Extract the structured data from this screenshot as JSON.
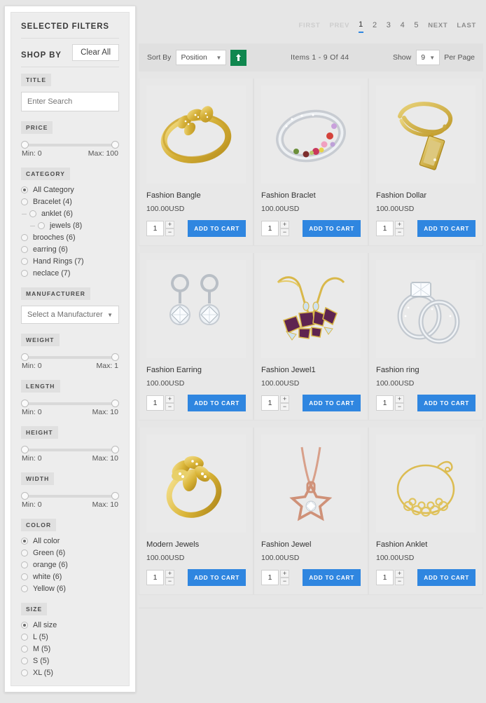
{
  "sidebar": {
    "selected_filters_title": "SELECTED FILTERS",
    "clear_all_label": "Clear All",
    "shop_by_title": "SHOP BY",
    "title_section": {
      "label": "TITLE",
      "search_placeholder": "Enter Search",
      "search_value": ""
    },
    "price_section": {
      "label": "PRICE",
      "min_text": "Min: 0",
      "max_text": "Max: 100"
    },
    "category_section": {
      "label": "CATEGORY",
      "options": [
        {
          "label": "All Category",
          "selected": true,
          "indent": 0
        },
        {
          "label": "Bracelet (4)",
          "selected": false,
          "indent": 0
        },
        {
          "label": "anklet (6)",
          "selected": false,
          "indent": 1
        },
        {
          "label": "jewels (8)",
          "selected": false,
          "indent": 2
        },
        {
          "label": "brooches (6)",
          "selected": false,
          "indent": 0
        },
        {
          "label": "earring (6)",
          "selected": false,
          "indent": 0
        },
        {
          "label": "Hand Rings (7)",
          "selected": false,
          "indent": 0
        },
        {
          "label": "neclace (7)",
          "selected": false,
          "indent": 0
        }
      ]
    },
    "manufacturer_section": {
      "label": "MANUFACTURER",
      "selected_value": "Select a Manufacturer"
    },
    "weight_section": {
      "label": "WEIGHT",
      "min_text": "Min: 0",
      "max_text": "Max: 1"
    },
    "length_section": {
      "label": "LENGTH",
      "min_text": "Min: 0",
      "max_text": "Max: 10"
    },
    "height_section": {
      "label": "HEIGHT",
      "min_text": "Min: 0",
      "max_text": "Max: 10"
    },
    "width_section": {
      "label": "WIDTH",
      "min_text": "Min: 0",
      "max_text": "Max: 10"
    },
    "color_section": {
      "label": "COLOR",
      "options": [
        {
          "label": "All color",
          "selected": true
        },
        {
          "label": "Green (6)",
          "selected": false
        },
        {
          "label": "orange (6)",
          "selected": false
        },
        {
          "label": "white (6)",
          "selected": false
        },
        {
          "label": "Yellow (6)",
          "selected": false
        }
      ]
    },
    "size_section": {
      "label": "SIZE",
      "options": [
        {
          "label": "All size",
          "selected": true
        },
        {
          "label": "L (5)",
          "selected": false
        },
        {
          "label": "M (5)",
          "selected": false
        },
        {
          "label": "S (5)",
          "selected": false
        },
        {
          "label": "XL (5)",
          "selected": false
        }
      ]
    }
  },
  "pagination": {
    "first": "FIRST",
    "prev": "PREV",
    "pages": [
      "1",
      "2",
      "3",
      "4",
      "5"
    ],
    "active_page": "1",
    "next": "NEXT",
    "last": "LAST"
  },
  "toolbar": {
    "sort_by_label": "Sort By",
    "sort_by_value": "Position",
    "sort_direction_icon": "arrow-up-icon",
    "items_text": "Items  1 - 9  Of  44",
    "show_label": "Show",
    "show_value": "9",
    "per_page_label": "Per Page"
  },
  "products": [
    {
      "name": "Fashion Bangle",
      "price": "100.00USD",
      "qty": "1",
      "add_to_cart": "ADD TO CART",
      "image": "gold-bangle"
    },
    {
      "name": "Fashion Braclet",
      "price": "100.00USD",
      "qty": "1",
      "add_to_cart": "ADD TO CART",
      "image": "silver-gem-bracelet"
    },
    {
      "name": "Fashion Dollar",
      "price": "100.00USD",
      "qty": "1",
      "add_to_cart": "ADD TO CART",
      "image": "gold-chain-pendant"
    },
    {
      "name": "Fashion Earring",
      "price": "100.00USD",
      "qty": "1",
      "add_to_cart": "ADD TO CART",
      "image": "silver-diamond-earrings"
    },
    {
      "name": "Fashion Jewel1",
      "price": "100.00USD",
      "qty": "1",
      "add_to_cart": "ADD TO CART",
      "image": "purple-gem-necklace-set"
    },
    {
      "name": "Fashion ring",
      "price": "100.00USD",
      "qty": "1",
      "add_to_cart": "ADD TO CART",
      "image": "silver-diamond-rings"
    },
    {
      "name": "Modern Jewels",
      "price": "100.00USD",
      "qty": "1",
      "add_to_cart": "ADD TO CART",
      "image": "gold-flower-ring"
    },
    {
      "name": "Fashion Jewel",
      "price": "100.00USD",
      "qty": "1",
      "add_to_cart": "ADD TO CART",
      "image": "rose-gold-star-pendant"
    },
    {
      "name": "Fashion Anklet",
      "price": "100.00USD",
      "qty": "1",
      "add_to_cart": "ADD TO CART",
      "image": "gold-anklet-chain"
    }
  ],
  "colors": {
    "accent_blue": "#2f86e0",
    "sort_green": "#10874f",
    "page_bg": "#e6e6e6",
    "panel_bg": "#ededed"
  },
  "stepper": {
    "plus": "+",
    "minus": "−"
  }
}
